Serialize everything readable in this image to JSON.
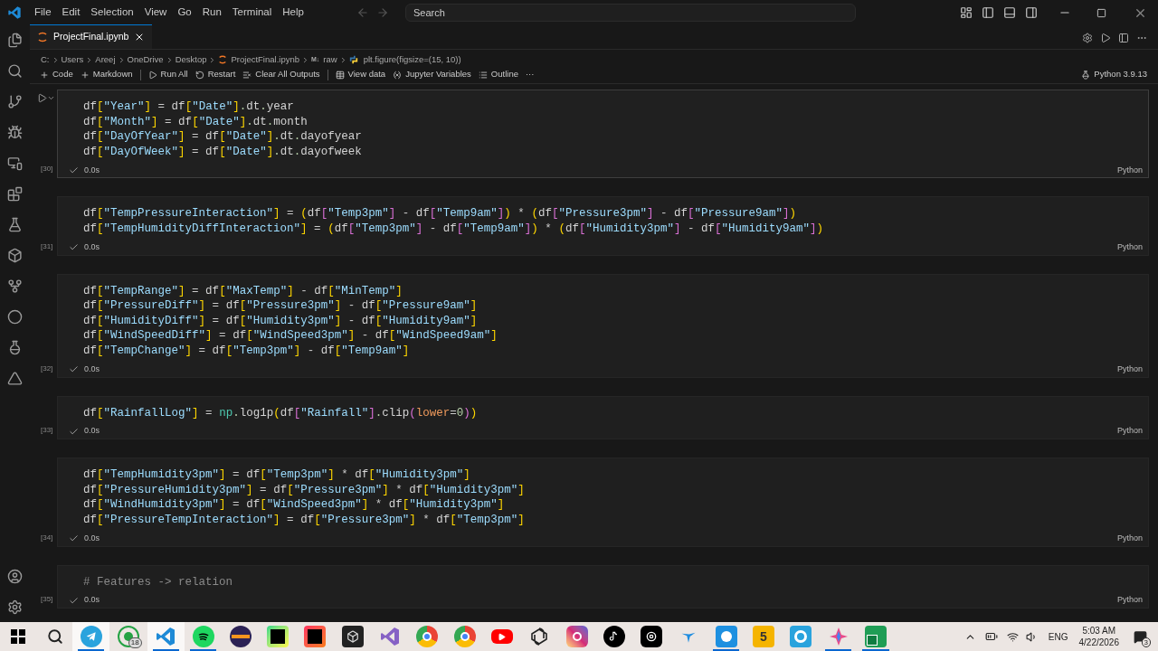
{
  "menu": [
    "File",
    "Edit",
    "Selection",
    "View",
    "Go",
    "Run",
    "Terminal",
    "Help"
  ],
  "search": {
    "placeholder": "Search"
  },
  "tab": {
    "label": "ProjectFinal.ipynb",
    "selected": true
  },
  "breadcrumb": [
    {
      "kind": "drive",
      "label": "C:"
    },
    {
      "kind": "text",
      "label": "Users"
    },
    {
      "kind": "text",
      "label": "Areej"
    },
    {
      "kind": "text",
      "label": "OneDrive"
    },
    {
      "kind": "text",
      "label": "Desktop"
    },
    {
      "kind": "notebook",
      "label": "ProjectFinal.ipynb"
    },
    {
      "kind": "markdown",
      "icon_text": "M↓",
      "label": "raw"
    },
    {
      "kind": "python",
      "label": "plt.figure(figsize=(15, 10))"
    }
  ],
  "toolbar": [
    {
      "kind": "plus",
      "label": "Code"
    },
    {
      "kind": "plus",
      "label": "Markdown"
    },
    {
      "kind": "sep"
    },
    {
      "kind": "run",
      "label": "Run All"
    },
    {
      "kind": "restart",
      "label": "Restart"
    },
    {
      "kind": "clear",
      "label": "Clear All Outputs"
    },
    {
      "kind": "sep"
    },
    {
      "kind": "table",
      "label": "View data"
    },
    {
      "kind": "variables",
      "label": "Jupyter Variables"
    },
    {
      "kind": "outline",
      "label": "Outline"
    },
    {
      "kind": "more",
      "label": "···"
    }
  ],
  "kernel": "Python 3.9.13",
  "cells": [
    {
      "count": "[30]",
      "time": "0.0s",
      "language": "Python",
      "hovered": true,
      "lines": [
        "df[\"Year\"] = df[\"Date\"].dt.year",
        "df[\"Month\"] = df[\"Date\"].dt.month",
        "df[\"DayOfYear\"] = df[\"Date\"].dt.dayofyear",
        "df[\"DayOfWeek\"] = df[\"Date\"].dt.dayofweek"
      ]
    },
    {
      "count": "[31]",
      "time": "0.0s",
      "language": "Python",
      "hovered": false,
      "lines": [
        "df[\"TempPressureInteraction\"] = (df[\"Temp3pm\"] - df[\"Temp9am\"]) * (df[\"Pressure3pm\"] - df[\"Pressure9am\"])",
        "df[\"TempHumidityDiffInteraction\"] = (df[\"Temp3pm\"] - df[\"Temp9am\"]) * (df[\"Humidity3pm\"] - df[\"Humidity9am\"])"
      ]
    },
    {
      "count": "[32]",
      "time": "0.0s",
      "language": "Python",
      "hovered": false,
      "lines": [
        "df[\"TempRange\"] = df[\"MaxTemp\"] - df[\"MinTemp\"]",
        "df[\"PressureDiff\"] = df[\"Pressure3pm\"] - df[\"Pressure9am\"]",
        "df[\"HumidityDiff\"] = df[\"Humidity3pm\"] - df[\"Humidity9am\"]",
        "df[\"WindSpeedDiff\"] = df[\"WindSpeed3pm\"] - df[\"WindSpeed9am\"]",
        "df[\"TempChange\"] = df[\"Temp3pm\"] - df[\"Temp9am\"]"
      ]
    },
    {
      "count": "[33]",
      "time": "0.0s",
      "language": "Python",
      "hovered": false,
      "lines": [
        "df[\"RainfallLog\"] = np.log1p(df[\"Rainfall\"].clip(lower=0))"
      ]
    },
    {
      "count": "[34]",
      "time": "0.0s",
      "language": "Python",
      "hovered": false,
      "lines": [
        "df[\"TempHumidity3pm\"] = df[\"Temp3pm\"] * df[\"Humidity3pm\"]",
        "df[\"PressureHumidity3pm\"] = df[\"Pressure3pm\"] * df[\"Humidity3pm\"]",
        "df[\"WindHumidity3pm\"] = df[\"WindSpeed3pm\"] * df[\"Humidity3pm\"]",
        "df[\"PressureTempInteraction\"] = df[\"Pressure3pm\"] * df[\"Temp3pm\"]"
      ]
    },
    {
      "count": "[35]",
      "time": "0.0s",
      "language": "Python",
      "hovered": false,
      "lines": [
        "# Features -> relation"
      ]
    }
  ],
  "taskbar": {
    "apps": [
      {
        "kind": "telegram",
        "running": true,
        "selected": true
      },
      {
        "kind": "whatsapp",
        "running": false,
        "selected": false,
        "badge": "18"
      },
      {
        "kind": "vscode",
        "running": true,
        "selected": true
      },
      {
        "kind": "spotify",
        "running": true,
        "selected": false
      },
      {
        "kind": "eclipse",
        "running": false,
        "selected": false
      },
      {
        "kind": "pycharm",
        "running": false,
        "selected": false
      },
      {
        "kind": "intellij",
        "running": false,
        "selected": false
      },
      {
        "kind": "cube",
        "running": false,
        "selected": false
      },
      {
        "kind": "studio",
        "running": false,
        "selected": false
      },
      {
        "kind": "chrome",
        "running": false,
        "selected": false
      },
      {
        "kind": "chrome",
        "running": false,
        "selected": false
      },
      {
        "kind": "youtube",
        "running": false,
        "selected": false
      },
      {
        "kind": "knot",
        "running": false,
        "selected": false
      },
      {
        "kind": "instagram",
        "running": false,
        "selected": false
      },
      {
        "kind": "tiktok",
        "running": false,
        "selected": false
      },
      {
        "kind": "threads",
        "running": false,
        "selected": false
      },
      {
        "kind": "bird",
        "running": false,
        "selected": false
      },
      {
        "kind": "bluebox",
        "running": true,
        "selected": false
      },
      {
        "kind": "five",
        "running": false,
        "selected": false,
        "label": "5"
      },
      {
        "kind": "ring",
        "running": false,
        "selected": false
      },
      {
        "kind": "star",
        "running": true,
        "selected": false
      },
      {
        "kind": "excel",
        "running": true,
        "selected": false
      }
    ],
    "language": "ENG",
    "time": "5:03 AM",
    "date": "4/22/2026",
    "notifications": "3"
  }
}
